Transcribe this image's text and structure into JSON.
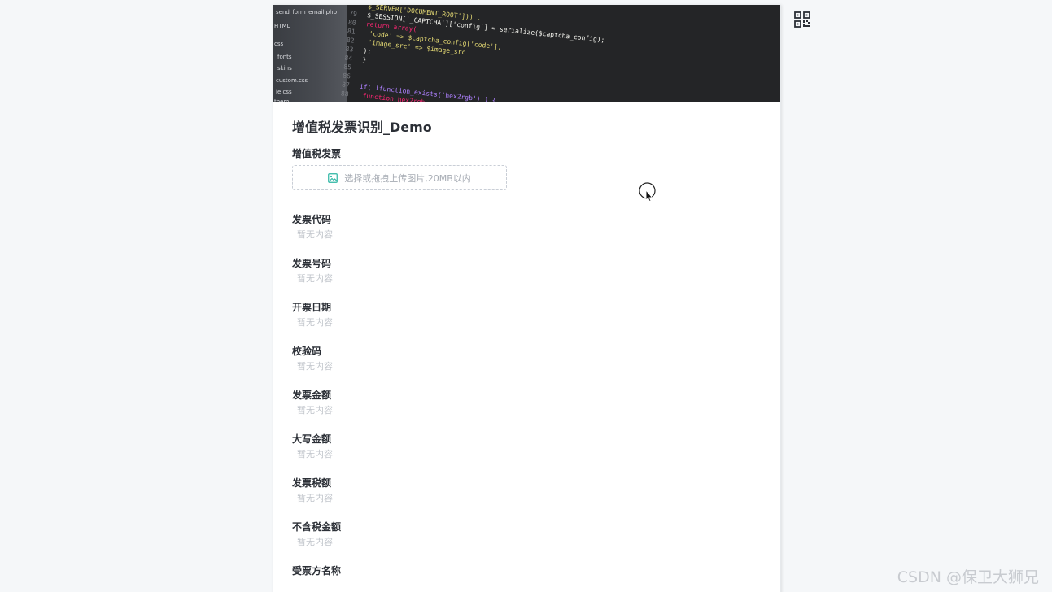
{
  "banner": {
    "alt": "code-background",
    "sidebar_items": [
      "send_form_email.php",
      "HTML",
      "css",
      "fonts",
      "skins",
      "custom.css",
      "ie.css",
      "them"
    ],
    "code_lines": [
      {
        "n": "79",
        "t": "$_SESSION['_CAPTCHA']['config'] = serialize($captcha_config);"
      },
      {
        "n": "80",
        "t": "return array("
      },
      {
        "n": "81",
        "t": "  'code' => $captcha_config['code'],"
      },
      {
        "n": "82",
        "t": "  'image_src' => $image_src"
      },
      {
        "n": "83",
        "t": ");"
      },
      {
        "n": "84",
        "t": "}"
      },
      {
        "n": "85",
        "t": ""
      },
      {
        "n": "86",
        "t": ""
      },
      {
        "n": "87",
        "t": "if( !function_exists('hex2rgb') ) {"
      },
      {
        "n": "88",
        "t": "  function hex2rgb"
      },
      {
        "n": "89",
        "t": ""
      },
      {
        "n": "90",
        "t": ""
      }
    ],
    "top_line": "_replace('/\\\\\\\\/', '/', $image_src), '/'); . '?_CAPTCHA&amp;t=' . ur",
    "server_line": "$_SERVER['DOCUMENT_ROOT'])) ."
  },
  "form": {
    "title": "增值税发票识别_Demo",
    "upload_label": "增值税发票",
    "upload_placeholder": "选择或拖拽上传图片,20MB以内",
    "empty_text": "暂无内容",
    "fields": [
      {
        "label": "发票代码",
        "value": "暂无内容"
      },
      {
        "label": "发票号码",
        "value": "暂无内容"
      },
      {
        "label": "开票日期",
        "value": "暂无内容"
      },
      {
        "label": "校验码",
        "value": "暂无内容"
      },
      {
        "label": "发票金额",
        "value": "暂无内容"
      },
      {
        "label": "大写金额",
        "value": "暂无内容"
      },
      {
        "label": "发票税额",
        "value": "暂无内容"
      },
      {
        "label": "不含税金额",
        "value": "暂无内容"
      },
      {
        "label": "受票方名称",
        "value": ""
      }
    ]
  },
  "qr_icon": "qr-code-icon",
  "watermark": "CSDN @保卫大狮兄",
  "colors": {
    "page_bg": "#f5f7f9",
    "banner_bg": "#242527",
    "placeholder": "#c2c6cc",
    "accent_icon": "#2bb5a3"
  }
}
